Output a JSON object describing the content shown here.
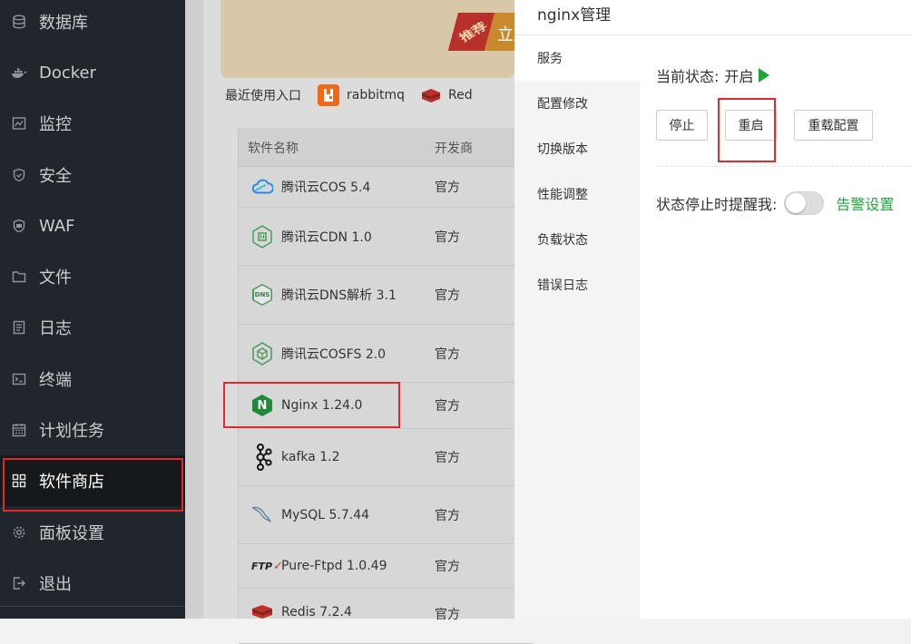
{
  "sidebar": {
    "items": [
      {
        "label": "数据库",
        "icon": "database-icon"
      },
      {
        "label": "Docker",
        "icon": "docker-icon"
      },
      {
        "label": "监控",
        "icon": "monitor-icon"
      },
      {
        "label": "安全",
        "icon": "shield-icon"
      },
      {
        "label": "WAF",
        "icon": "waf-icon"
      },
      {
        "label": "文件",
        "icon": "folder-icon"
      },
      {
        "label": "日志",
        "icon": "log-icon"
      },
      {
        "label": "终端",
        "icon": "terminal-icon"
      },
      {
        "label": "计划任务",
        "icon": "calendar-icon"
      },
      {
        "label": "软件商店",
        "icon": "grid-icon"
      },
      {
        "label": "面板设置",
        "icon": "gear-icon"
      },
      {
        "label": "退出",
        "icon": "logout-icon"
      }
    ],
    "active": "软件商店"
  },
  "store": {
    "banner_badge": "推荐",
    "banner_button": "立",
    "recent_label": "最近使用入口",
    "recent_items": [
      "rabbitmq",
      "Red"
    ],
    "columns": {
      "name": "软件名称",
      "developer": "开发商"
    },
    "rows": [
      {
        "name": "腾讯云COS 5.4",
        "developer": "官方",
        "icon": "cloud-icon"
      },
      {
        "name": "腾讯云CDN 1.0",
        "developer": "官方",
        "icon": "cdn-icon"
      },
      {
        "name": "腾讯云DNS解析 3.1",
        "developer": "官方",
        "icon": "dns-icon",
        "icon_text": "DNS"
      },
      {
        "name": "腾讯云COSFS 2.0",
        "developer": "官方",
        "icon": "cosfs-icon"
      },
      {
        "name": "Nginx 1.24.0",
        "developer": "官方",
        "icon": "nginx-icon",
        "icon_text": "N"
      },
      {
        "name": "kafka 1.2",
        "developer": "官方",
        "icon": "kafka-icon"
      },
      {
        "name": "MySQL 5.7.44",
        "developer": "官方",
        "icon": "mysql-icon"
      },
      {
        "name": "Pure-Ftpd 1.0.49",
        "developer": "官方",
        "icon": "ftp-icon",
        "icon_text": "FTP"
      },
      {
        "name": "Redis 7.2.4",
        "developer": "官方",
        "icon": "redis-icon"
      }
    ]
  },
  "drawer": {
    "title": "nginx管理",
    "nav": [
      "服务",
      "配置修改",
      "切换版本",
      "性能调整",
      "负载状态",
      "错误日志"
    ],
    "active_nav": "服务",
    "status_label": "当前状态:",
    "status_value": "开启",
    "buttons": {
      "stop": "停止",
      "restart": "重启",
      "reload": "重载配置"
    },
    "alert_label": "状态停止时提醒我:",
    "alert_toggle_on": false,
    "alert_link": "告警设置"
  },
  "colors": {
    "sidebar_bg": "#20262b",
    "accent_green": "#20a53a",
    "highlight_red": "#e0282d"
  }
}
